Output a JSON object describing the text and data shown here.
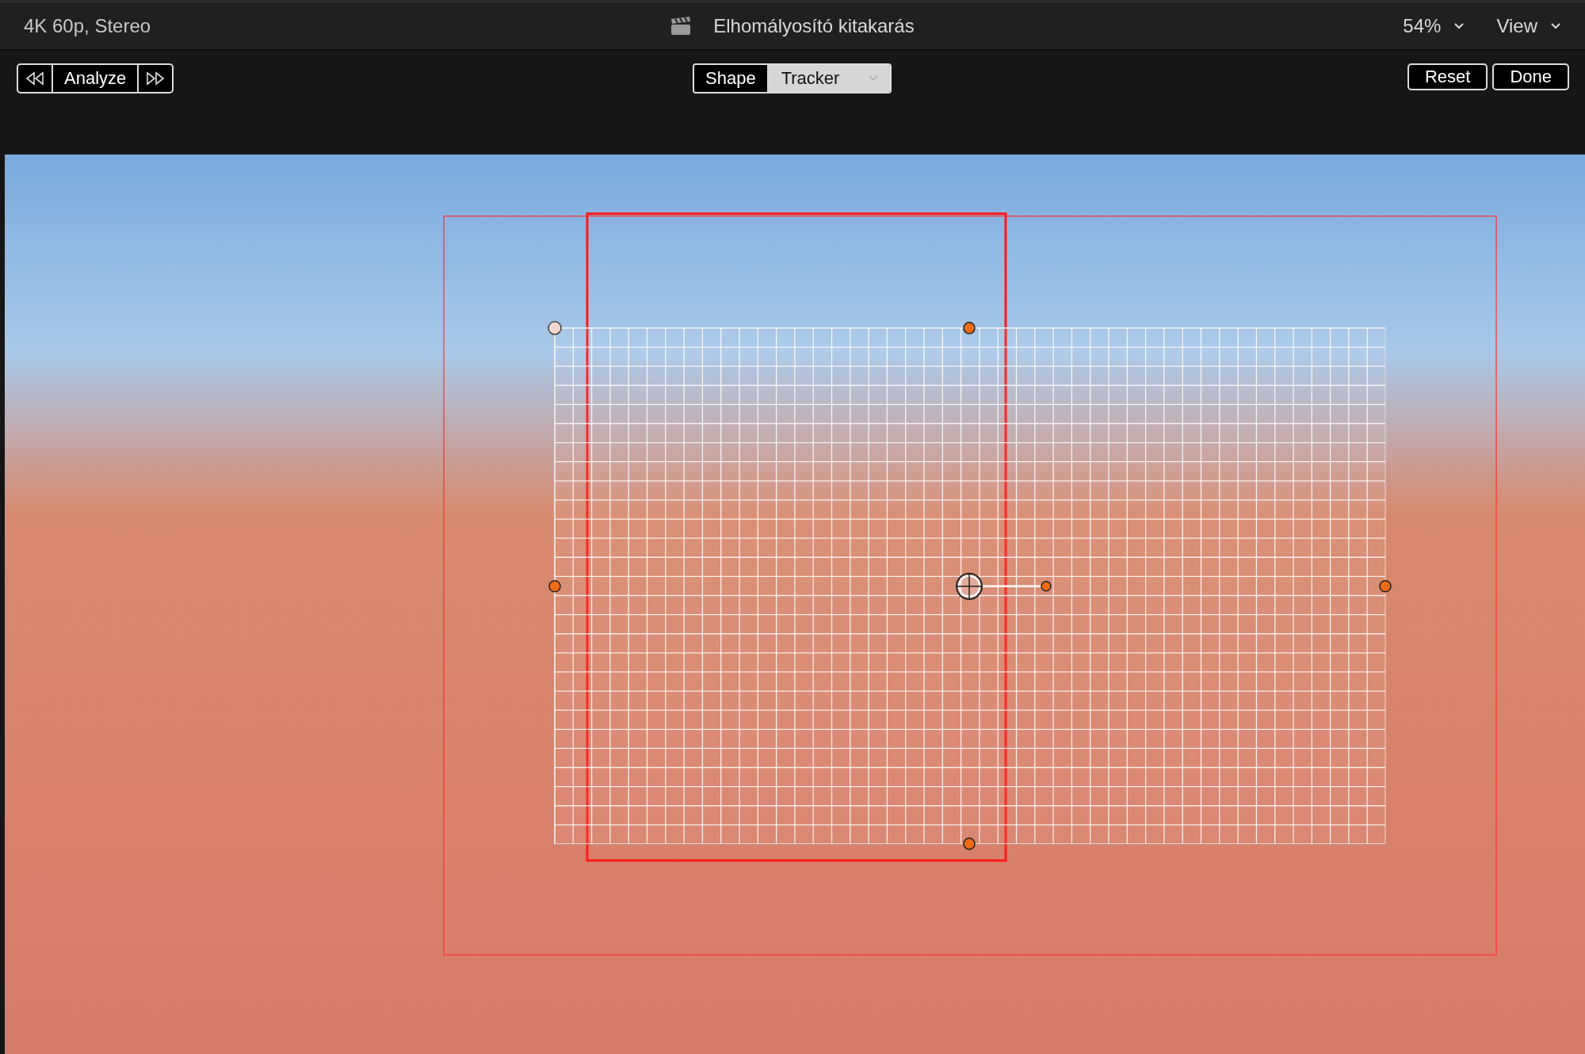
{
  "header": {
    "format": "4K 60p, Stereo",
    "title": "Elhomályosító kitakarás",
    "zoom": "54%",
    "view": "View"
  },
  "analyze": {
    "label": "Analyze"
  },
  "mode_tabs": [
    {
      "label": "Shape",
      "selected": true
    },
    {
      "label": "Tracker",
      "selected": false
    }
  ],
  "buttons": [
    "Reset",
    "Done"
  ]
}
